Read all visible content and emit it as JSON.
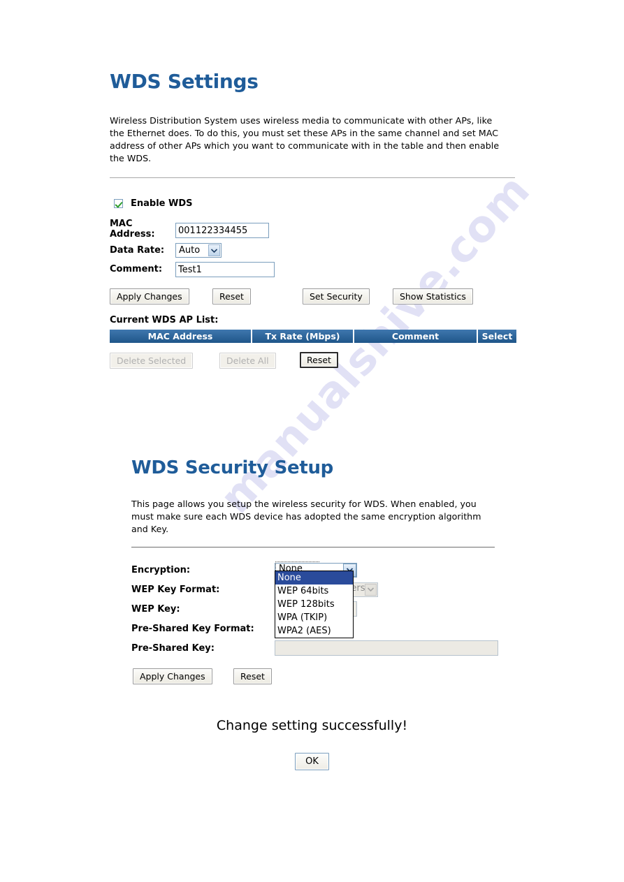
{
  "watermark": {
    "text": "manualshive.com"
  },
  "colors": {
    "heading": "#1f5c99",
    "table_header_bg": "#2f6ba5",
    "dropdown_selected_bg": "#2a4b9b",
    "checkbox_check": "#2a9d2a"
  },
  "wds_settings": {
    "title": "WDS Settings",
    "intro": "Wireless Distribution System uses wireless media to communicate with other APs, like the Ethernet does. To do this, you must set these APs in the same channel and set MAC address of other APs which you want to communicate with in the table and then enable the WDS.",
    "enable_checkbox": {
      "label": "Enable WDS",
      "checked": true
    },
    "fields": {
      "mac_address": {
        "label": "MAC Address:",
        "value": "001122334455",
        "placeholder": ""
      },
      "data_rate": {
        "label": "Data Rate:",
        "value": "Auto"
      },
      "comment": {
        "label": "Comment:",
        "value": "Test1",
        "placeholder": ""
      }
    },
    "buttons": {
      "apply_changes": "Apply Changes",
      "reset": "Reset",
      "set_security": "Set Security",
      "show_statistics": "Show Statistics"
    },
    "list_label": "Current WDS AP List:",
    "table": {
      "columns": [
        "MAC Address",
        "Tx Rate (Mbps)",
        "Comment",
        "Select"
      ],
      "rows": []
    },
    "table_buttons": {
      "delete_selected": "Delete Selected",
      "delete_all": "Delete All",
      "reset": "Reset"
    }
  },
  "wds_security": {
    "title": "WDS Security Setup",
    "intro": "This page allows you setup the wireless security for WDS. When enabled, you must make sure each WDS device has adopted the same encryption algorithm and Key.",
    "fields": {
      "encryption": {
        "label": "Encryption:",
        "value": "None",
        "options": [
          "None",
          "WEP 64bits",
          "WEP 128bits",
          "WPA (TKIP)",
          "WPA2 (AES)"
        ],
        "open": true,
        "selected_index": 0
      },
      "wep_key_format": {
        "label": "WEP Key Format:",
        "value": "ASCII (5 characters)",
        "disabled": true
      },
      "wep_key": {
        "label": "WEP Key:",
        "value": "",
        "disabled": true
      },
      "psk_format": {
        "label": "Pre-Shared Key Format:",
        "value": "",
        "disabled": true
      },
      "psk": {
        "label": "Pre-Shared Key:",
        "value": "",
        "disabled": true
      }
    },
    "buttons": {
      "apply_changes": "Apply Changes",
      "reset": "Reset"
    }
  },
  "result": {
    "message": "Change setting successfully!",
    "ok_label": "OK"
  }
}
